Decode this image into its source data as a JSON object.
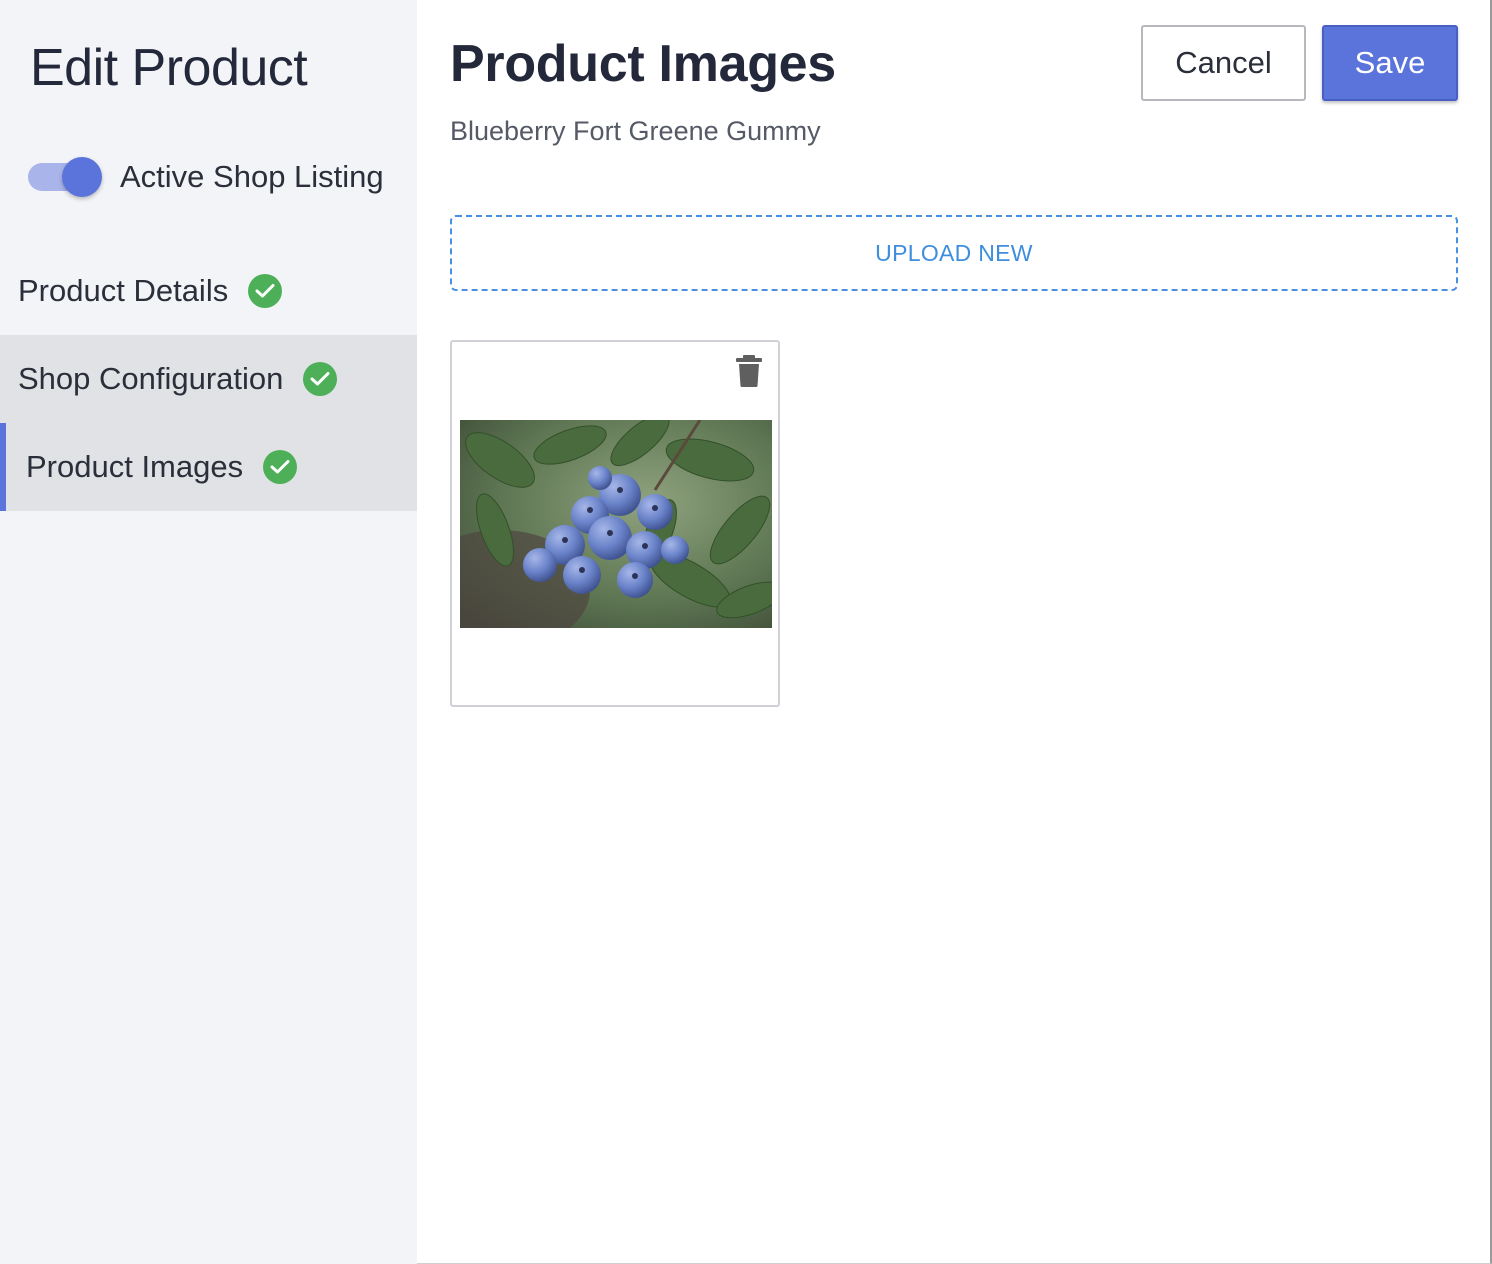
{
  "sidebar": {
    "title": "Edit Product",
    "toggle": {
      "label": "Active Shop Listing",
      "on": true
    },
    "items": [
      {
        "label": "Product Details",
        "status": "complete"
      },
      {
        "label": "Shop Configuration",
        "status": "complete"
      },
      {
        "label": "Product Images",
        "status": "complete",
        "active": true
      }
    ]
  },
  "header": {
    "title": "Product Images",
    "subtitle": "Blueberry Fort Greene Gummy",
    "cancel_label": "Cancel",
    "save_label": "Save"
  },
  "upload": {
    "label": "UPLOAD NEW"
  },
  "images": [
    {
      "description": "blueberries",
      "delete_icon": "trash-icon"
    }
  ],
  "colors": {
    "accent": "#5b74db",
    "success": "#4db058",
    "link": "#3f8ede"
  }
}
